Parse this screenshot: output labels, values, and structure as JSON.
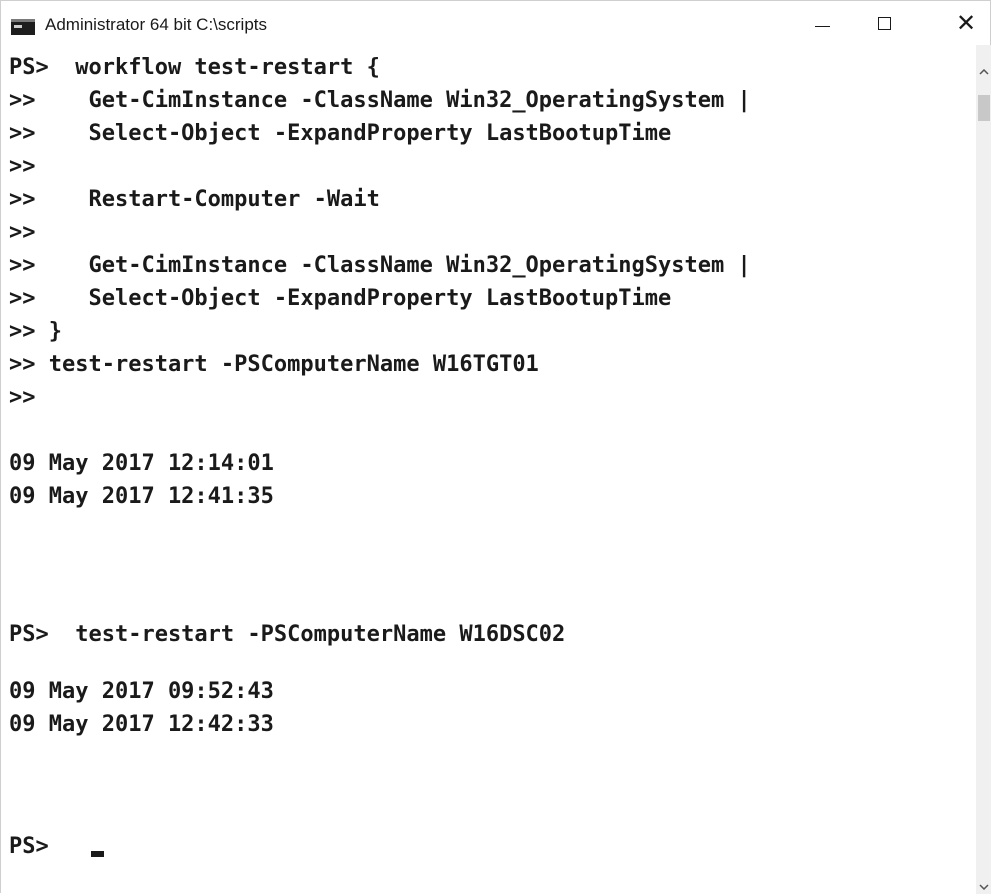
{
  "window": {
    "title": "Administrator 64 bit C:\\scripts",
    "icon": "console-icon",
    "controls": {
      "minimize": "minimize-icon",
      "maximize": "maximize-icon",
      "close": "close-icon"
    }
  },
  "console": {
    "lines": [
      "PS>  workflow test-restart {",
      ">>    Get-CimInstance -ClassName Win32_OperatingSystem |",
      ">>    Select-Object -ExpandProperty LastBootupTime",
      ">>",
      ">>    Restart-Computer -Wait",
      ">>",
      ">>    Get-CimInstance -ClassName Win32_OperatingSystem |",
      ">>    Select-Object -ExpandProperty LastBootupTime",
      ">> }",
      ">> test-restart -PSComputerName W16TGT01",
      ">>",
      "",
      "09 May 2017 12:14:01",
      "09 May 2017 12:41:35",
      "",
      "",
      "PS>  test-restart -PSComputerName W16DSC02",
      "",
      "09 May 2017 09:52:43",
      "09 May 2017 12:42:33",
      "",
      "",
      "PS>  "
    ]
  },
  "colors": {
    "background": "#ffffff",
    "text": "#1a1a1a",
    "scrollbar": "#f0f0f0"
  }
}
